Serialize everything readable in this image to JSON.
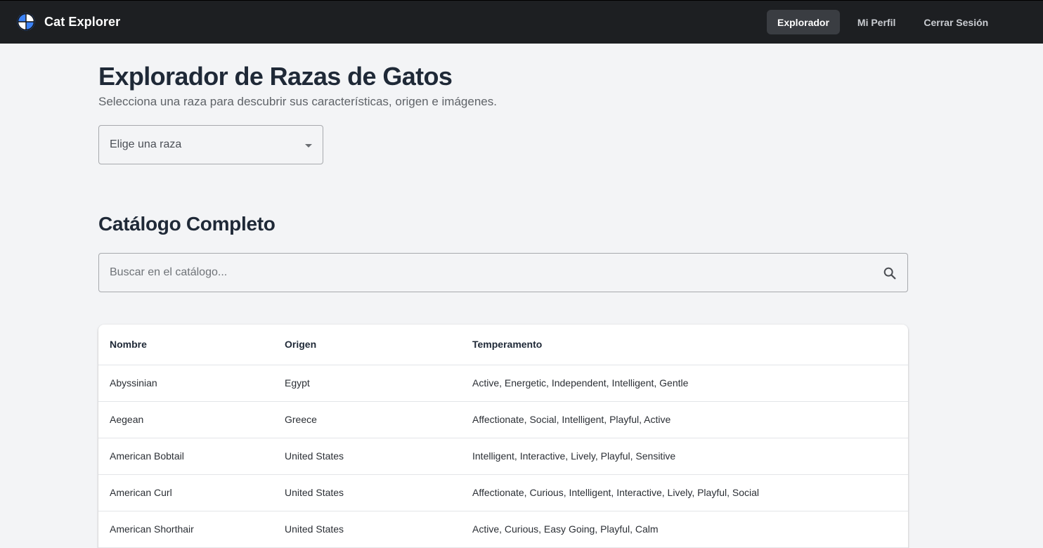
{
  "header": {
    "brand_icon": "cat-explorer-logo-icon",
    "brand_name": "Cat Explorer",
    "nav": [
      {
        "label": "Explorador",
        "active": true
      },
      {
        "label": "Mi Perfil",
        "active": false
      },
      {
        "label": "Cerrar Sesión",
        "active": false
      }
    ]
  },
  "main": {
    "title": "Explorador de Razas de Gatos",
    "subtitle": "Selecciona una raza para descubrir sus características, origen e imágenes.",
    "breed_select": {
      "placeholder": "Elige una raza",
      "icon": "dropdown-arrow-icon"
    },
    "catalog": {
      "title": "Catálogo Completo",
      "search_placeholder": "Buscar en el catálogo...",
      "search_icon": "search-icon",
      "columns": [
        "Nombre",
        "Origen",
        "Temperamento"
      ],
      "rows": [
        [
          "Abyssinian",
          "Egypt",
          "Active, Energetic, Independent, Intelligent, Gentle"
        ],
        [
          "Aegean",
          "Greece",
          "Affectionate, Social, Intelligent, Playful, Active"
        ],
        [
          "American Bobtail",
          "United States",
          "Intelligent, Interactive, Lively, Playful, Sensitive"
        ],
        [
          "American Curl",
          "United States",
          "Affectionate, Curious, Intelligent, Interactive, Lively, Playful, Social"
        ],
        [
          "American Shorthair",
          "United States",
          "Active, Curious, Easy Going, Playful, Calm"
        ]
      ]
    }
  },
  "colors": {
    "navbar_bg": "#1d1f22",
    "page_bg": "#f3f4f6",
    "logo_blue": "#3b82f6",
    "active_nav_bg": "#3a3d42"
  }
}
